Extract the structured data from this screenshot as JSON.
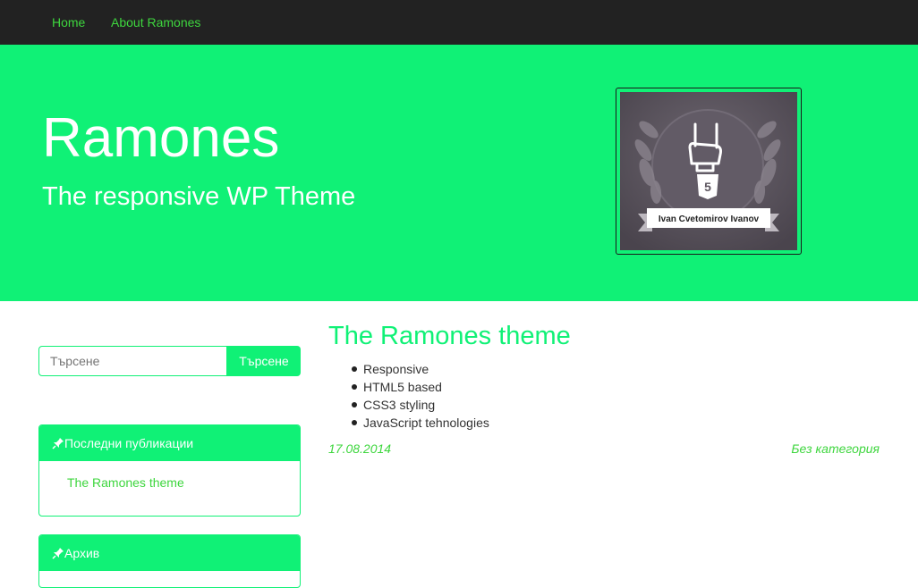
{
  "nav": {
    "items": [
      {
        "label": "Home"
      },
      {
        "label": "About Ramones"
      }
    ]
  },
  "hero": {
    "title": "Ramones",
    "tagline": "The responsive WP Theme",
    "logo_caption": "Ivan Cvetomirov Ivanov",
    "logo_badge": "5"
  },
  "sidebar": {
    "search": {
      "placeholder": "Търсене",
      "button_label": "Търсене"
    },
    "recent": {
      "heading": "Последни публикации",
      "links": [
        "The Ramones theme"
      ]
    },
    "archive": {
      "heading": "Архив"
    }
  },
  "post": {
    "title": "The Ramones theme",
    "features": [
      "Responsive",
      "HTML5 based",
      "CSS3 styling",
      "JavaScript tehnologies"
    ],
    "date": "17.08.2014",
    "category": "Без категория"
  },
  "colors": {
    "accent": "#10f176",
    "link": "#3ed63e",
    "navbar": "#222222"
  }
}
